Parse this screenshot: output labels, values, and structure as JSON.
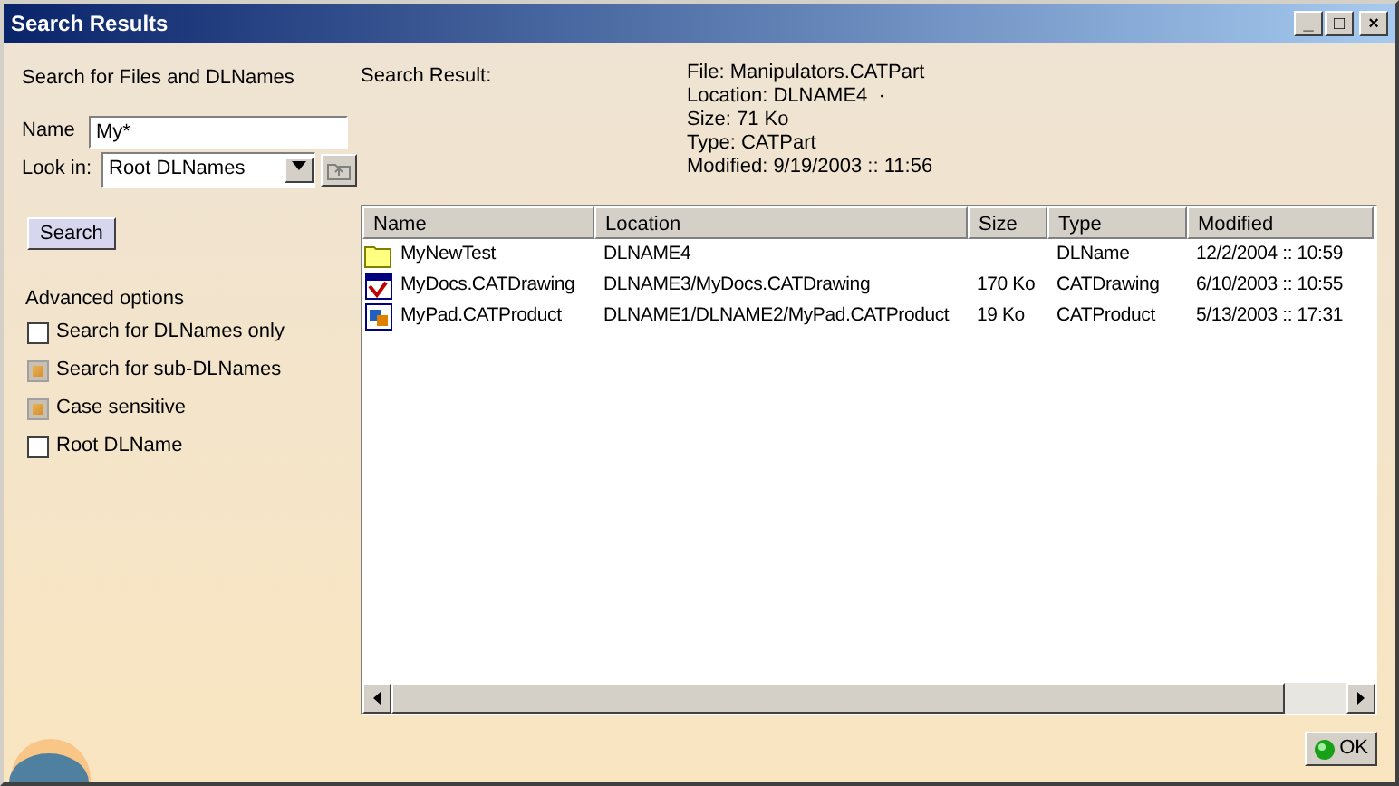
{
  "window": {
    "title": "Search Results",
    "controls": [
      "_",
      "□",
      "×"
    ]
  },
  "search_panel": {
    "heading": "Search for Files and DLNames",
    "name_label": "Name",
    "name_value": "My*",
    "look_in_label": "Look in:",
    "look_in_value": "Root DLNames",
    "search_button": "Search",
    "advanced_heading": "Advanced options",
    "options": [
      {
        "label": "Search for DLNames only",
        "checked": false
      },
      {
        "label": "Search for sub-DLNames",
        "checked": true
      },
      {
        "label": "Case sensitive",
        "checked": true
      },
      {
        "label": "Root DLName",
        "checked": false
      }
    ]
  },
  "result": {
    "label": "Search Result:",
    "details": [
      "File: Manipulators.CATPart",
      "Location: DLNAME4  ·",
      "Size: 71 Ko",
      "Type: CATPart",
      "Modified: 9/19/2003 :: 11:56"
    ]
  },
  "table": {
    "columns": [
      "Name",
      "Location",
      "Size",
      "Type",
      "Modified"
    ],
    "rows": [
      {
        "kind": "folder",
        "cells": [
          "MyNewTest",
          "DLNAME4",
          "",
          "DLName",
          "12/2/2004 :: 10:59"
        ]
      },
      {
        "kind": "drawing",
        "cells": [
          "MyDocs.CATDrawing",
          "DLNAME3/MyDocs.CATDrawing",
          "170 Ko",
          "CATDrawing",
          "6/10/2003 :: 10:55"
        ]
      },
      {
        "kind": "product",
        "cells": [
          "MyPad.CATProduct",
          "DLNAME1/DLNAME2/MyPad.CATProduct",
          "19 Ko",
          "CATProduct",
          "5/13/2003 :: 17:31"
        ]
      }
    ]
  },
  "ok_button": "OK"
}
